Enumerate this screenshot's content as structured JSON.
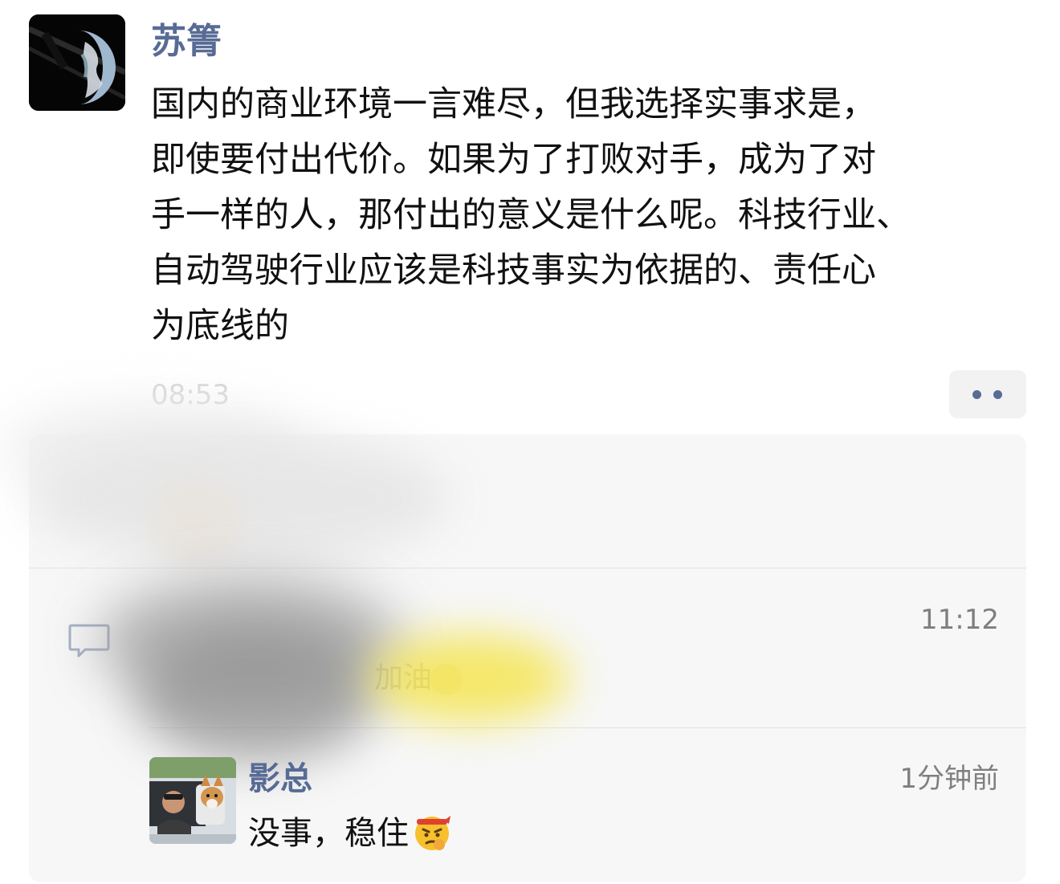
{
  "post": {
    "author": "苏箐",
    "lines": [
      "国内的商业环境一言难尽，但我选择实事求是，",
      "即使要付出代价。如果为了打败对手，成为了对",
      "手一样的人，那付出的意义是什么呢。科技行业、",
      "自动驾驶行业应该是科技事实为依据的、责任心",
      "为底线的"
    ],
    "time": "08:53",
    "more_icon": "more-dots-icon",
    "avatar_icon": "earth-from-space-avatar"
  },
  "interactions": {
    "comment_icon": "comment-bubble-icon",
    "comment_time": "11:12",
    "comment_text": "加油",
    "comment_emoji": "muscle-emoji-icon",
    "reply": {
      "author": "影总",
      "time": "1分钟前",
      "text": "没事，稳住",
      "emoji": "determined-face-emoji",
      "avatar_icon": "person-with-corgi-in-car-avatar"
    }
  },
  "colors": {
    "name_blue": "#576b95",
    "panel_bg": "#f7f7f7",
    "meta_gray": "#7f7f7f"
  }
}
